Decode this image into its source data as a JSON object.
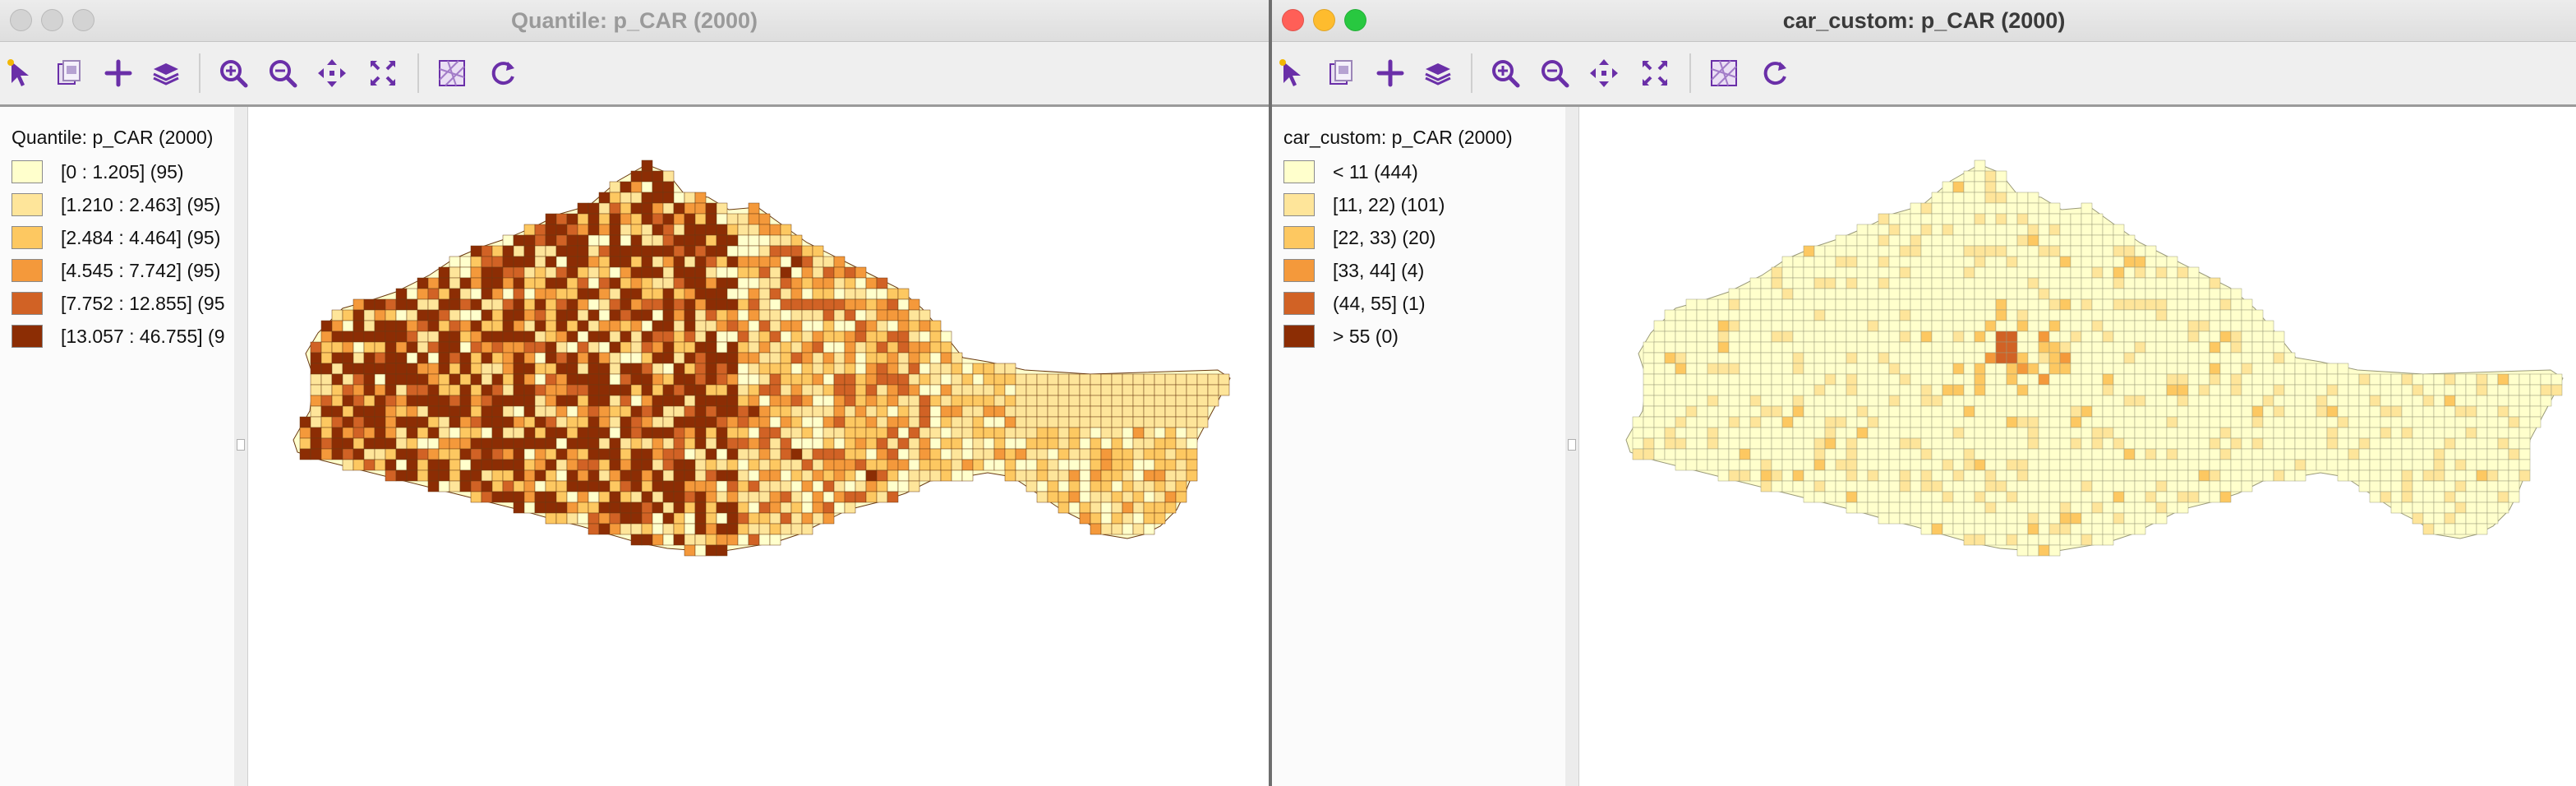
{
  "windows": [
    {
      "title": "Quantile: p_CAR (2000)",
      "active": false,
      "legend": {
        "title": "Quantile: p_CAR (2000)",
        "items": [
          {
            "label": "[0 : 1.205] (95)",
            "color": "#ffffcc"
          },
          {
            "label": "[1.210 : 2.463] (95)",
            "color": "#fee59a"
          },
          {
            "label": "[2.484 : 4.464] (95)",
            "color": "#fdc861"
          },
          {
            "label": "[4.545 : 7.742] (95)",
            "color": "#f4993b"
          },
          {
            "label": "[7.752 : 12.855] (95",
            "color": "#d16225"
          },
          {
            "label": "[13.057 : 46.755] (9",
            "color": "#8c2d04"
          }
        ]
      }
    },
    {
      "title": "car_custom: p_CAR (2000)",
      "active": true,
      "legend": {
        "title": "car_custom: p_CAR (2000)",
        "items": [
          {
            "label": "< 11 (444)",
            "color": "#ffffcc"
          },
          {
            "label": "[11, 22) (101)",
            "color": "#fee59a"
          },
          {
            "label": "[22, 33) (20)",
            "color": "#fdc861"
          },
          {
            "label": "[33, 44] (4)",
            "color": "#f4993b"
          },
          {
            "label": "(44, 55] (1)",
            "color": "#d16225"
          },
          {
            "label": "> 55 (0)",
            "color": "#8c2d04"
          }
        ]
      }
    }
  ],
  "toolbar_icons": [
    "select-arrow-icon",
    "copy-image-icon",
    "add-plus-icon",
    "layers-icon",
    "zoom-in-icon",
    "zoom-out-icon",
    "pan-icon",
    "full-extent-icon",
    "basemap-icon",
    "refresh-icon"
  ],
  "traffic_lights": {
    "close": "#ff5f57",
    "minimize": "#febc2e",
    "zoom": "#28c840",
    "inactive": "#d3d3d3"
  },
  "accent_color": "#6a2fa8"
}
